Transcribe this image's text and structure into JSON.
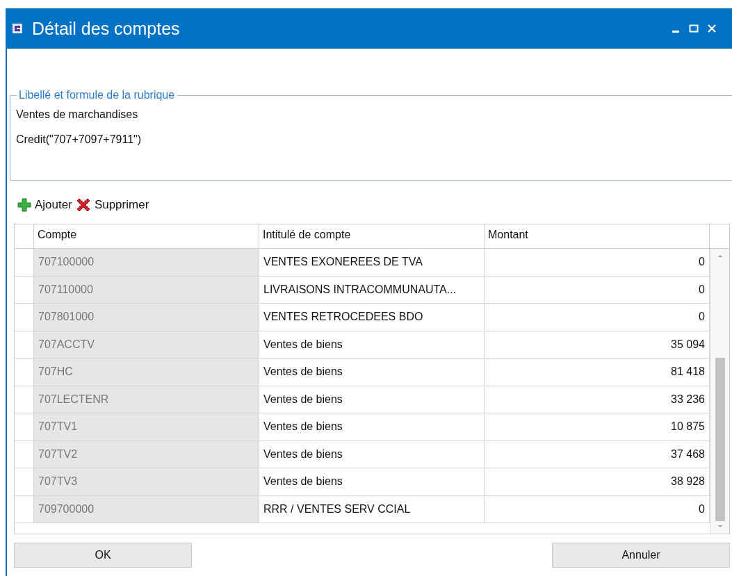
{
  "window": {
    "title": "Détail des comptes"
  },
  "group": {
    "legend": "Libellé et formule de la rubrique",
    "label": "Ventes de marchandises",
    "formula": "Credit(\"707+7097+7911\")"
  },
  "toolbar": [
    {
      "kind": "add",
      "label": "Ajouter"
    },
    {
      "kind": "delete",
      "label": "Supprimer"
    }
  ],
  "table": {
    "columns": [
      "Compte",
      "Intitulé de compte",
      "Montant"
    ],
    "rows": [
      {
        "compte": "707100000",
        "intitule": "VENTES EXONEREES DE TVA",
        "montant": "0"
      },
      {
        "compte": "707110000",
        "intitule": "LIVRAISONS INTRACOMMUNAUTA...",
        "montant": "0"
      },
      {
        "compte": "707801000",
        "intitule": "VENTES RETROCEDEES BDO",
        "montant": "0"
      },
      {
        "compte": "707ACCTV",
        "intitule": "Ventes de biens",
        "montant": "35 094"
      },
      {
        "compte": "707HC",
        "intitule": "Ventes de biens",
        "montant": "81 418"
      },
      {
        "compte": "707LECTENR",
        "intitule": "Ventes de biens",
        "montant": "33 236"
      },
      {
        "compte": "707TV1",
        "intitule": "Ventes de biens",
        "montant": "10 875"
      },
      {
        "compte": "707TV2",
        "intitule": "Ventes de biens",
        "montant": "37 468"
      },
      {
        "compte": "707TV3",
        "intitule": "Ventes de biens",
        "montant": "38 928"
      },
      {
        "compte": "709700000",
        "intitule": "RRR / VENTES SERV CCIAL",
        "montant": "0"
      }
    ]
  },
  "buttons": [
    "OK",
    "Annuler"
  ]
}
